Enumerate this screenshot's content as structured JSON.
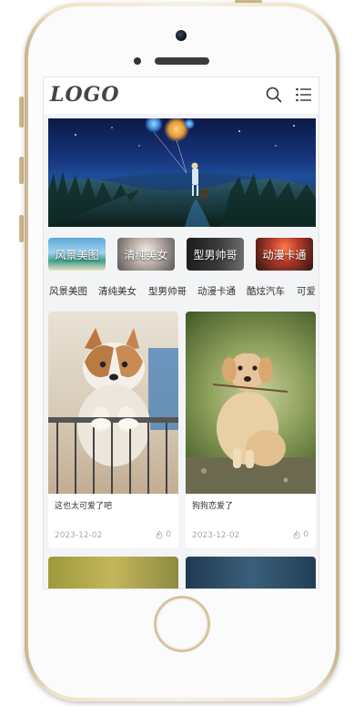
{
  "header": {
    "logo_text": "LOGO"
  },
  "categories": [
    {
      "label": "风景美图"
    },
    {
      "label": "清纯美女"
    },
    {
      "label": "型男帅哥"
    },
    {
      "label": "动漫卡通"
    }
  ],
  "tabs": [
    "风景美图",
    "清纯美女",
    "型男帅哥",
    "动漫卡通",
    "酷炫汽车",
    "可爱"
  ],
  "posts": [
    {
      "title": "这也太可爱了吧",
      "date": "2023-12-02",
      "likes": "0"
    },
    {
      "title": "狗狗恋爱了",
      "date": "2023-12-02",
      "likes": "0"
    }
  ],
  "colors": {
    "frame_gold": "#e8dbbd",
    "screen_bg": "#f3f4f6",
    "text_main": "#333333",
    "text_muted": "#aaaaaa"
  }
}
